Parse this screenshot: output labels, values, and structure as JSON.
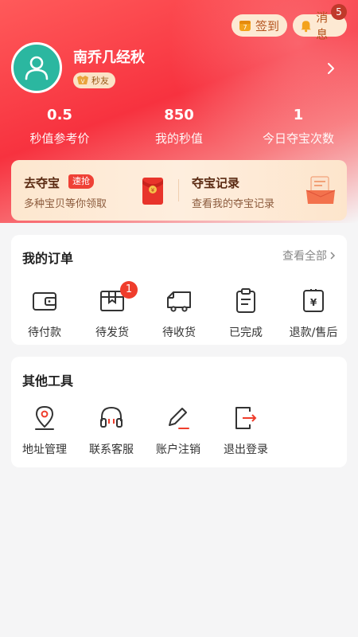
{
  "header": {
    "checkin_label": "签到",
    "message_label": "消息",
    "message_count": "5",
    "username": "南乔几经秋",
    "level_label": "秒友",
    "stats": [
      {
        "value": "0.5",
        "label": "秒值参考价"
      },
      {
        "value": "850",
        "label": "我的秒值"
      },
      {
        "value": "1",
        "label": "今日夺宝次数"
      }
    ]
  },
  "treasure": {
    "left_title": "去夺宝",
    "left_tag": "速抢",
    "left_sub": "多种宝贝等你领取",
    "right_title": "夺宝记录",
    "right_sub": "查看我的夺宝记录"
  },
  "orders": {
    "title": "我的订单",
    "view_all": "查看全部",
    "items": [
      {
        "label": "待付款",
        "icon": "wallet-icon"
      },
      {
        "label": "待发货",
        "icon": "package-icon",
        "badge": "1"
      },
      {
        "label": "待收货",
        "icon": "truck-icon"
      },
      {
        "label": "已完成",
        "icon": "clipboard-icon"
      },
      {
        "label": "退款/售后",
        "icon": "refund-icon"
      }
    ]
  },
  "tools": {
    "title": "其他工具",
    "items": [
      {
        "label": "地址管理",
        "icon": "location-icon"
      },
      {
        "label": "联系客服",
        "icon": "headset-icon"
      },
      {
        "label": "账户注销",
        "icon": "pen-icon"
      },
      {
        "label": "退出登录",
        "icon": "logout-icon"
      }
    ]
  },
  "colors": {
    "brand_red": "#f7323f",
    "accent_gold": "#fde9d3",
    "avatar_teal": "#2bb7a0"
  }
}
